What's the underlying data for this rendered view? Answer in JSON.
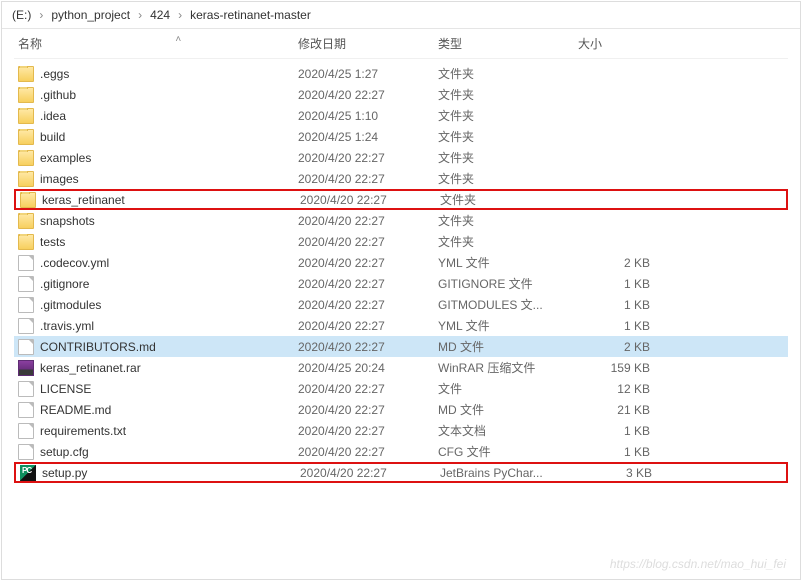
{
  "breadcrumb": {
    "drive": "(E:)",
    "segments": [
      "python_project",
      "424",
      "keras-retinanet-master"
    ]
  },
  "columns": {
    "name": "名称",
    "date": "修改日期",
    "type": "类型",
    "size": "大小"
  },
  "rows": [
    {
      "icon": "folder",
      "name": ".eggs",
      "date": "2020/4/25 1:27",
      "type": "文件夹",
      "size": ""
    },
    {
      "icon": "folder",
      "name": ".github",
      "date": "2020/4/20 22:27",
      "type": "文件夹",
      "size": ""
    },
    {
      "icon": "folder",
      "name": ".idea",
      "date": "2020/4/25 1:10",
      "type": "文件夹",
      "size": ""
    },
    {
      "icon": "folder",
      "name": "build",
      "date": "2020/4/25 1:24",
      "type": "文件夹",
      "size": ""
    },
    {
      "icon": "folder",
      "name": "examples",
      "date": "2020/4/20 22:27",
      "type": "文件夹",
      "size": ""
    },
    {
      "icon": "folder",
      "name": "images",
      "date": "2020/4/20 22:27",
      "type": "文件夹",
      "size": ""
    },
    {
      "icon": "folder",
      "name": "keras_retinanet",
      "date": "2020/4/20 22:27",
      "type": "文件夹",
      "size": "",
      "highlight": true
    },
    {
      "icon": "folder",
      "name": "snapshots",
      "date": "2020/4/20 22:27",
      "type": "文件夹",
      "size": ""
    },
    {
      "icon": "folder",
      "name": "tests",
      "date": "2020/4/20 22:27",
      "type": "文件夹",
      "size": ""
    },
    {
      "icon": "file",
      "name": ".codecov.yml",
      "date": "2020/4/20 22:27",
      "type": "YML 文件",
      "size": "2 KB"
    },
    {
      "icon": "file",
      "name": ".gitignore",
      "date": "2020/4/20 22:27",
      "type": "GITIGNORE 文件",
      "size": "1 KB"
    },
    {
      "icon": "file",
      "name": ".gitmodules",
      "date": "2020/4/20 22:27",
      "type": "GITMODULES 文...",
      "size": "1 KB"
    },
    {
      "icon": "file",
      "name": ".travis.yml",
      "date": "2020/4/20 22:27",
      "type": "YML 文件",
      "size": "1 KB"
    },
    {
      "icon": "file",
      "name": "CONTRIBUTORS.md",
      "date": "2020/4/20 22:27",
      "type": "MD 文件",
      "size": "2 KB",
      "selected": true
    },
    {
      "icon": "rar",
      "name": "keras_retinanet.rar",
      "date": "2020/4/25 20:24",
      "type": "WinRAR 压缩文件",
      "size": "159 KB"
    },
    {
      "icon": "file",
      "name": "LICENSE",
      "date": "2020/4/20 22:27",
      "type": "文件",
      "size": "12 KB"
    },
    {
      "icon": "file",
      "name": "README.md",
      "date": "2020/4/20 22:27",
      "type": "MD 文件",
      "size": "21 KB"
    },
    {
      "icon": "file",
      "name": "requirements.txt",
      "date": "2020/4/20 22:27",
      "type": "文本文档",
      "size": "1 KB"
    },
    {
      "icon": "file",
      "name": "setup.cfg",
      "date": "2020/4/20 22:27",
      "type": "CFG 文件",
      "size": "1 KB"
    },
    {
      "icon": "pycharm",
      "name": "setup.py",
      "date": "2020/4/20 22:27",
      "type": "JetBrains PyChar...",
      "size": "3 KB",
      "highlight": true
    }
  ],
  "watermark": "https://blog.csdn.net/mao_hui_fei"
}
